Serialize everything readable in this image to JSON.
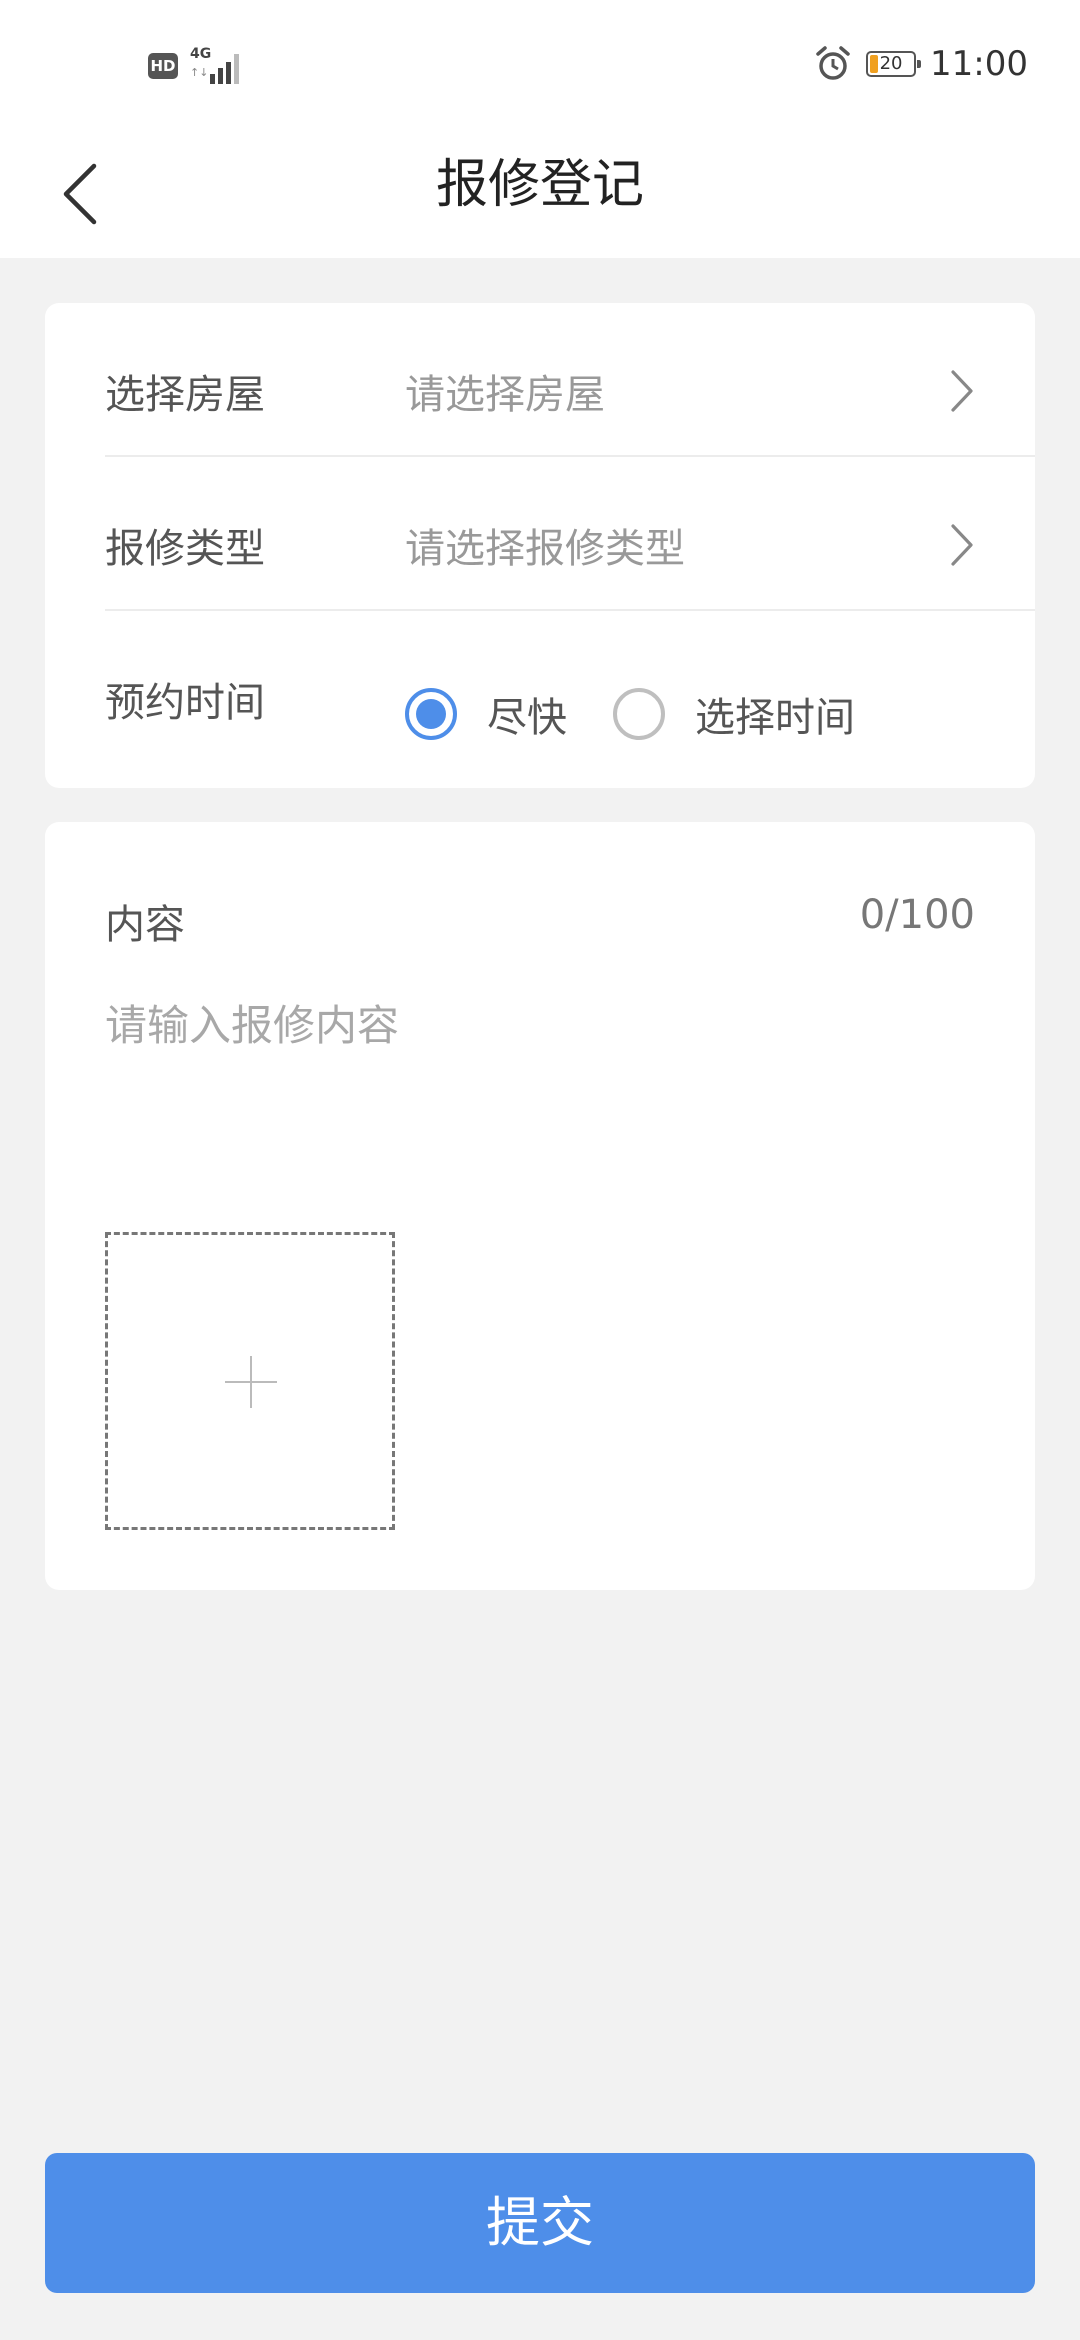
{
  "status_bar": {
    "hd": "HD",
    "network": "4G",
    "network_arrows": "↑↓",
    "battery": "20",
    "time": "11:00",
    "battery_color": "#f0a020"
  },
  "nav": {
    "title": "报修登记"
  },
  "form": {
    "house": {
      "label": "选择房屋",
      "placeholder": "请选择房屋"
    },
    "repair_type": {
      "label": "报修类型",
      "placeholder": "请选择报修类型"
    },
    "appointment": {
      "label": "预约时间",
      "options": [
        {
          "label": "尽快",
          "selected": true
        },
        {
          "label": "选择时间",
          "selected": false
        }
      ]
    },
    "content": {
      "label": "内容",
      "counter": "0/100",
      "placeholder": "请输入报修内容"
    }
  },
  "submit": {
    "label": "提交"
  },
  "colors": {
    "accent": "#4e8ee9",
    "background": "#f2f2f2",
    "card": "#ffffff"
  }
}
